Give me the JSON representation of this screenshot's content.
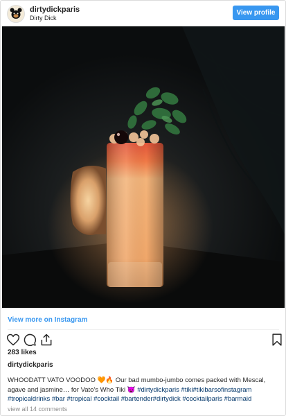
{
  "header": {
    "username": "dirtydickparis",
    "display_name": "Dirty Dick",
    "view_profile_label": "View profile"
  },
  "photo": {
    "description_icon": "cocktail-photo"
  },
  "links": {
    "view_more": "View more on Instagram"
  },
  "actions": {
    "icons": [
      "heart-icon",
      "comment-icon",
      "share-icon",
      "bookmark-icon"
    ]
  },
  "post": {
    "likes": "283 likes",
    "caption_user": "dirtydickparis",
    "caption_text": "WHOODATT VATO VOODOO 🧡🔥 Our bad mumbo-jumbo comes packed with Mescal, agave and jasmine… for Vato's Who Tiki 👿 ",
    "hashtags": [
      "#dirtydickparis",
      "#tiki",
      "#tikibarsofinstagram",
      "#tropicaldrinks",
      "#bar",
      "#tropical",
      "#cocktail",
      "#bartender",
      "#dirtydick",
      "#cocktailparis",
      "#barmaid"
    ],
    "comments_link": "view all 14 comments"
  },
  "colors": {
    "accent": "#3897f0",
    "hashtag": "#003569",
    "muted": "#8e8e8e"
  }
}
